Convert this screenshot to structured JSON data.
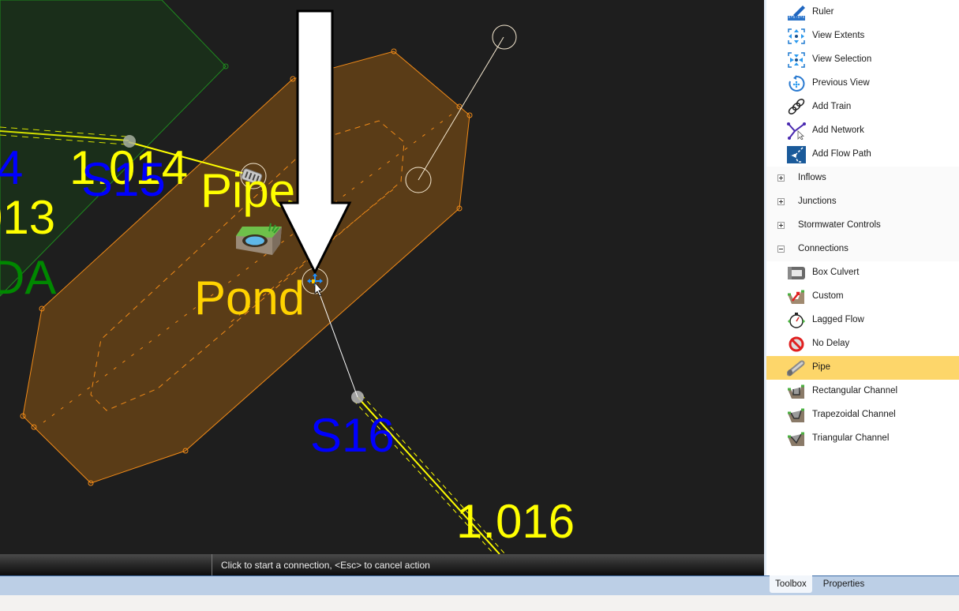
{
  "map": {
    "labels": {
      "s15": "S15",
      "s16": "S16",
      "link_1014": "1.014",
      "link_1016": "1.016",
      "link_1013_partial": "013",
      "node_4_partial": "4",
      "da_partial": "DA",
      "pipe": "Pipe",
      "pond": "Pond"
    },
    "colors": {
      "background": "#1e1e1e",
      "catchment_fill": "#1a2e1a",
      "catchment_stroke": "#1f8a1f",
      "pond_fill": "#5a3c17",
      "pond_stroke": "#f08a18",
      "link_yellow": "#ffff00",
      "node_label_blue": "#0000ff",
      "pond_label": "#ffd200",
      "catchment_label": "#008800"
    }
  },
  "status_bar": {
    "message": "Click to start a connection, <Esc> to cancel action"
  },
  "toolbox": {
    "tools": [
      {
        "label": "Ruler",
        "icon": "ruler-icon"
      },
      {
        "label": "View Extents",
        "icon": "view-extents-icon"
      },
      {
        "label": "View Selection",
        "icon": "view-selection-icon"
      },
      {
        "label": "Previous View",
        "icon": "previous-view-icon"
      },
      {
        "label": "Add Train",
        "icon": "add-train-icon"
      },
      {
        "label": "Add Network",
        "icon": "add-network-icon"
      },
      {
        "label": "Add Flow Path",
        "icon": "add-flow-path-icon"
      }
    ],
    "categories": [
      {
        "label": "Inflows",
        "expanded": false
      },
      {
        "label": "Junctions",
        "expanded": false
      },
      {
        "label": "Stormwater Controls",
        "expanded": false
      },
      {
        "label": "Connections",
        "expanded": true
      }
    ],
    "connections": [
      {
        "label": "Box Culvert",
        "icon": "box-culvert-icon"
      },
      {
        "label": "Custom",
        "icon": "custom-channel-icon"
      },
      {
        "label": "Lagged Flow",
        "icon": "lagged-flow-icon"
      },
      {
        "label": "No Delay",
        "icon": "no-delay-icon"
      },
      {
        "label": "Pipe",
        "icon": "pipe-icon",
        "selected": true
      },
      {
        "label": "Rectangular Channel",
        "icon": "rectangular-channel-icon"
      },
      {
        "label": "Trapezoidal Channel",
        "icon": "trapezoidal-channel-icon"
      },
      {
        "label": "Triangular Channel",
        "icon": "triangular-channel-icon"
      }
    ],
    "selected_color": "#fdd66a"
  },
  "panel_tabs": {
    "toolbox": "Toolbox",
    "properties": "Properties",
    "active": "Toolbox"
  }
}
